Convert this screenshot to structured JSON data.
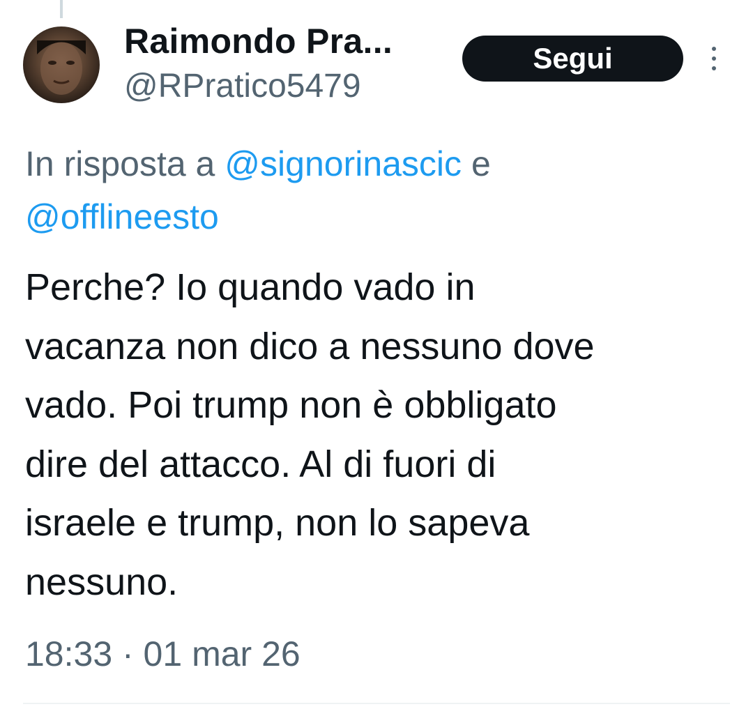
{
  "author": {
    "name": "Raimondo Pra...",
    "handle": "@RPratico5479"
  },
  "follow_label": "Segui",
  "reply_context": {
    "prefix": "In risposta a ",
    "mention_1": "@signorinascic",
    "conjunction": " e ",
    "mention_2": "@offlineesto"
  },
  "tweet_text": "Perche? Io quando vado in\nvacanza non dico a nessuno dove\nvado. Poi trump non è obbligato\ndire del attacco. Al di fuori di\nisraele e trump, non lo sapeva\nnessuno.",
  "timestamp": "18:33 · 01 mar 26",
  "icons": {
    "more": "more-vertical-icon",
    "avatar": "avatar-photo"
  },
  "colors": {
    "text": "#0f1419",
    "secondary": "#536471",
    "link": "#1d9bf0",
    "button": "#0f1419"
  }
}
